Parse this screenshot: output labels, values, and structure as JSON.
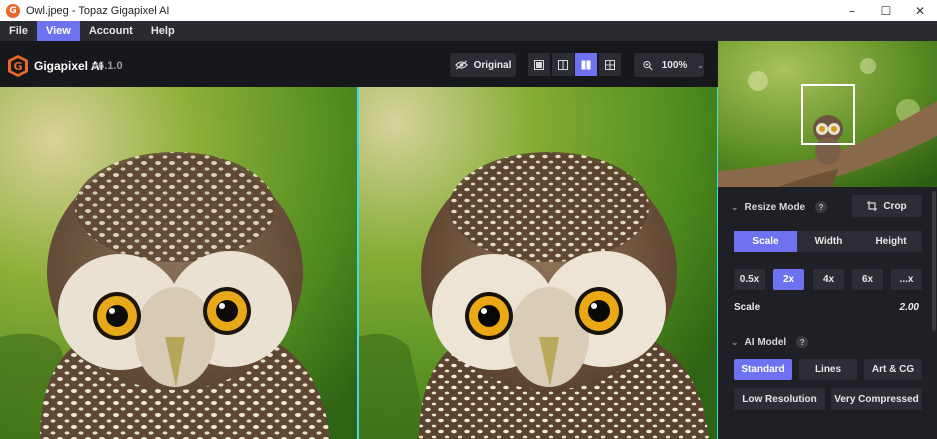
{
  "window": {
    "title": "Owl.jpeg - Topaz Gigapixel AI",
    "minimize": "–",
    "maximize": "☐",
    "close": "✕"
  },
  "menu": {
    "items": [
      "File",
      "View",
      "Account",
      "Help"
    ],
    "active": "View"
  },
  "toolbar": {
    "app_name": "Gigapixel AI",
    "version": "v6.1.0",
    "original_label": "Original",
    "zoom_label": "100%",
    "view_modes": [
      "single",
      "split",
      "side-by-side",
      "grid"
    ],
    "active_view": "side-by-side"
  },
  "resize": {
    "title": "Resize Mode",
    "help": "?",
    "crop_label": "Crop",
    "tabs": [
      "Scale",
      "Width",
      "Height"
    ],
    "active_tab": "Scale",
    "presets": [
      "0.5x",
      "2x",
      "4x",
      "6x",
      "...x"
    ],
    "active_preset": "2x",
    "scale_label": "Scale",
    "scale_value": "2.00"
  },
  "model": {
    "title": "AI Model",
    "help": "?",
    "row1": [
      "Standard",
      "Lines",
      "Art & CG"
    ],
    "row2": [
      "Low Resolution",
      "Very Compressed"
    ],
    "active": "Standard"
  },
  "colors": {
    "accent": "#6f72f0",
    "divider": "#39e0e6",
    "panel": "#1f2025",
    "toolbar": "#17181c"
  }
}
